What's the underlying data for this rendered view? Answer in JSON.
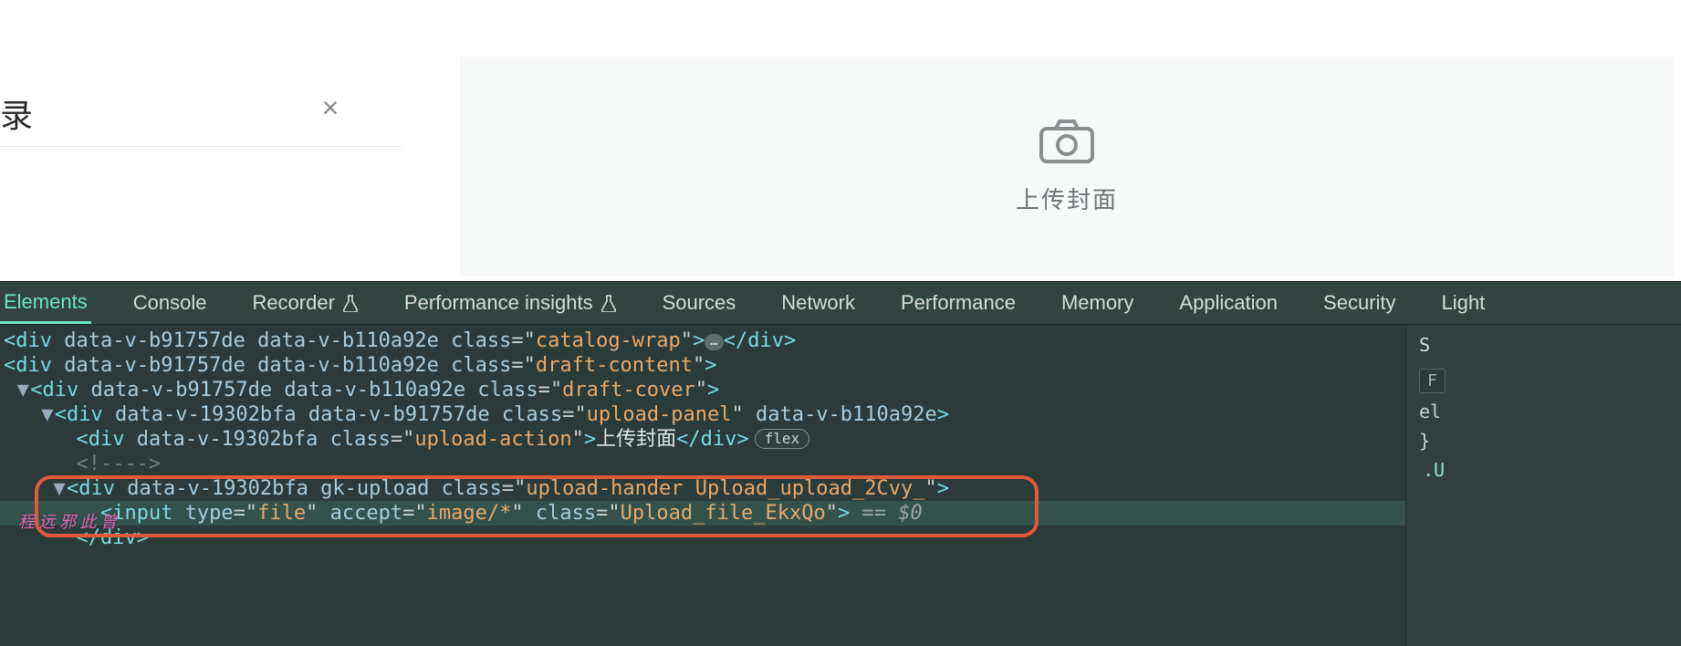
{
  "page": {
    "modal_title": "录",
    "close_glyph": "×",
    "cover_label": "上传封面"
  },
  "devtools": {
    "tabs": [
      "Elements",
      "Console",
      "Recorder",
      "Performance insights",
      "Sources",
      "Network",
      "Performance",
      "Memory",
      "Application",
      "Security",
      "Light"
    ],
    "active_tab": "Elements",
    "side": {
      "tab": "S",
      "filter_abbrev": "F",
      "el_label": "el",
      "brace": "}",
      "selector": ".U"
    },
    "dom": {
      "l1": {
        "open": "<div ",
        "a1n": "data-v-b91757de",
        "a2n": "data-v-b110a92e",
        "a3n": "class",
        "a3v": "catalog-wrap",
        "mid": ">",
        "ell": "…",
        "close": "</div>"
      },
      "l2": {
        "open": "<div ",
        "a1n": "data-v-b91757de",
        "a2n": "data-v-b110a92e",
        "a3n": "class",
        "a3v": "draft-content",
        "close": ">"
      },
      "l3": {
        "tri": "▼",
        "open": "<div ",
        "a1n": "data-v-b91757de",
        "a2n": "data-v-b110a92e",
        "a3n": "class",
        "a3v": "draft-cover",
        "close": ">"
      },
      "l4": {
        "tri": "▼",
        "open": "<div ",
        "a1n": "data-v-19302bfa",
        "a2n": "data-v-b91757de",
        "a3n": "class",
        "a3v": "upload-panel",
        "a4n": "data-v-b110a92e",
        "close": ">"
      },
      "l5": {
        "open": "<div ",
        "a1n": "data-v-19302bfa",
        "a2n": "class",
        "a2v": "upload-action",
        "mid": ">",
        "text": "上传封面",
        "close": "</div>",
        "badge": "flex"
      },
      "l6": {
        "comment": "<!---->"
      },
      "l7": {
        "tri": "▼",
        "open": "<div ",
        "a1n": "data-v-19302bfa",
        "a2n": "gk-upload",
        "a3n": "class",
        "a3v": "upload-hander Upload_upload_2Cvy_",
        "close": ">"
      },
      "l8": {
        "open": "<input ",
        "a1n": "type",
        "a1v": "file",
        "a2n": "accept",
        "a2v": "image/*",
        "a3n": "class",
        "a3v": "Upload_file_EkxQo",
        "close": ">",
        "eq0": " == $0"
      },
      "l9": {
        "close": "</div>"
      }
    }
  },
  "watermark": "程 远 邪 此 曾"
}
